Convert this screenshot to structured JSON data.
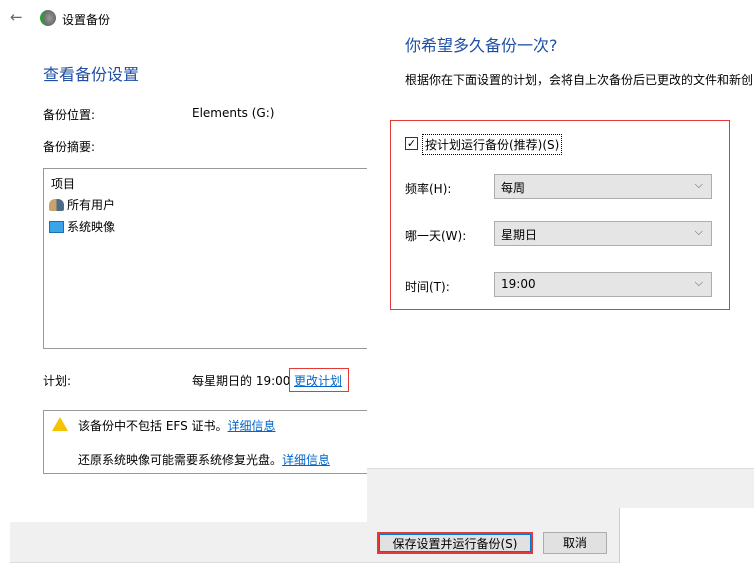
{
  "window": {
    "title": "设置备份",
    "back_icon": "arrow-left-icon"
  },
  "left": {
    "heading": "查看备份设置",
    "location_label": "备份位置:",
    "location_value": "Elements (G:)",
    "summary_label": "备份摘要:",
    "summary_header": "项目",
    "summary_items": [
      {
        "label": "所有用户",
        "icon": "users-icon"
      },
      {
        "label": "系统映像",
        "icon": "monitor-icon"
      }
    ],
    "schedule_label": "计划:",
    "schedule_value": "每星期日的 19:00",
    "change_schedule": "更改计划",
    "warning1": "该备份中不包括 EFS 证书。",
    "warning2": "还原系统映像可能需要系统修复光盘。",
    "more_info": "详细信息",
    "save_button": "保存设置并运行备份(S)",
    "cancel_button": "取消"
  },
  "right": {
    "heading": "你希望多久备份一次?",
    "description": "根据你在下面设置的计划，会将自上次备份后已更改的文件和新创",
    "run_on_schedule": "按计划运行备份(推荐)(S)",
    "run_on_schedule_checked": true,
    "frequency_label": "频率(H):",
    "frequency_value": "每周",
    "day_label": "哪一天(W):",
    "day_value": "星期日",
    "time_label": "时间(T):",
    "time_value": "19:00"
  }
}
